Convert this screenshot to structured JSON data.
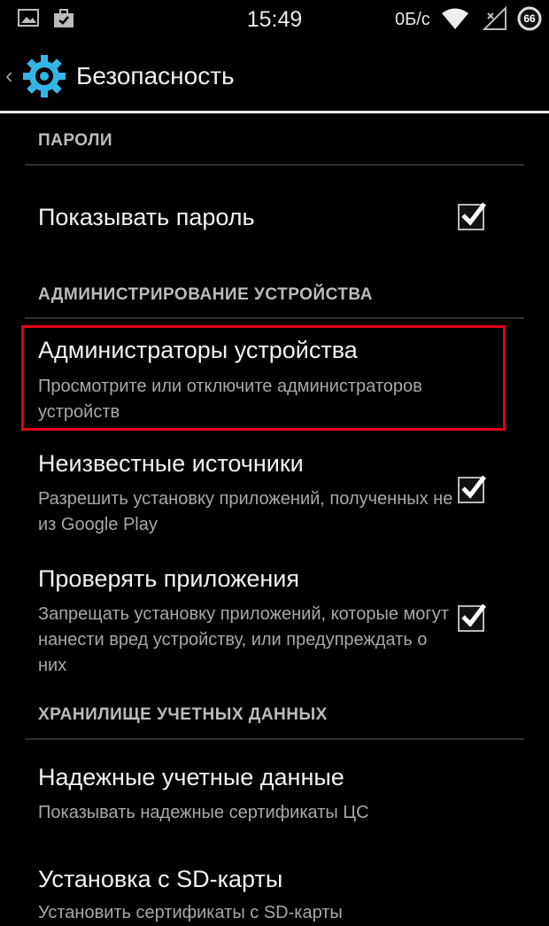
{
  "status_bar": {
    "time": "15:49",
    "speed": "0Б/с",
    "battery": "66",
    "icons": [
      "image-icon",
      "briefcase-icon",
      "wifi-icon",
      "signal-icon",
      "battery-icon"
    ]
  },
  "action_bar": {
    "title": "Безопасность",
    "icon": "settings-gear-icon"
  },
  "sections": {
    "passwords": "ПАРОЛИ",
    "device_admin": "АДМИНИСТРИРОВАНИЕ УСТРОЙСТВА",
    "credential_storage": "ХРАНИЛИЩЕ УЧЕТНЫХ ДАННЫХ"
  },
  "items": {
    "show_password": {
      "title": "Показывать пароль",
      "checked": true
    },
    "device_admins": {
      "title": "Администраторы устройства",
      "subtitle": "Просмотрите или отключите администраторов устройств"
    },
    "unknown_sources": {
      "title": "Неизвестные источники",
      "subtitle": "Разрешить установку приложений, полученных не из Google Play",
      "checked": true
    },
    "verify_apps": {
      "title": "Проверять приложения",
      "subtitle": "Запрещать установку приложений, которые могут нанести вред устройству, или предупреждать о них",
      "checked": true
    },
    "trusted_credentials": {
      "title": "Надежные учетные данные",
      "subtitle": "Показывать надежные сертификаты ЦС"
    },
    "install_from_sd": {
      "title": "Установка с SD-карты",
      "subtitle": "Установить сертификаты с SD-карты"
    }
  },
  "colors": {
    "highlight": "#e0001b",
    "accent": "#33b5e5"
  }
}
